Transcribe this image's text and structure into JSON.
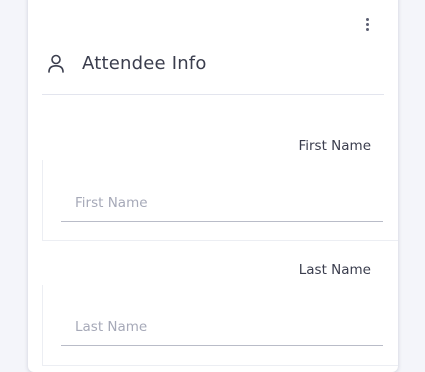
{
  "card": {
    "menu_icon": "more-vertical-icon",
    "header": {
      "icon": "user-icon",
      "title": "Attendee Info"
    }
  },
  "fields": {
    "first_name": {
      "label": "First Name",
      "value": "",
      "placeholder": "First Name"
    },
    "last_name": {
      "label": "Last Name",
      "value": "",
      "placeholder": "Last Name"
    }
  }
}
